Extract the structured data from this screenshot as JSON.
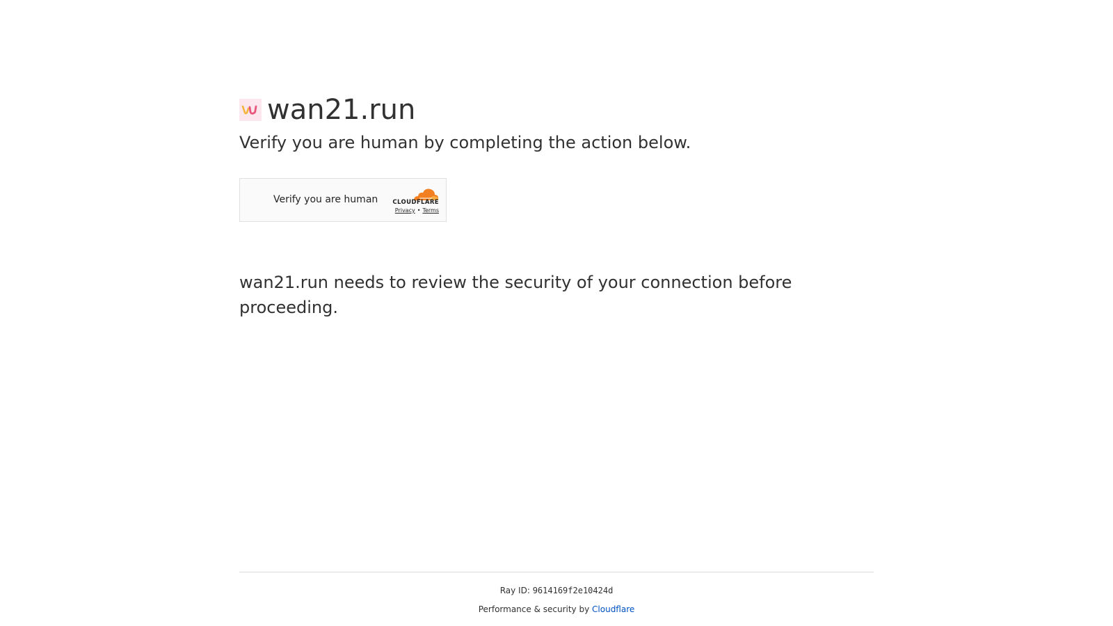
{
  "header": {
    "site_title": "wan21.run",
    "favicon_icon": "wan21-logo-icon"
  },
  "subtitle": "Verify you are human by completing the action below.",
  "widget": {
    "label": "Verify you are human",
    "brand": "CLOUDFLARE",
    "brand_icon": "cloudflare-cloud-icon",
    "privacy_link": "Privacy",
    "separator": "•",
    "terms_link": "Terms"
  },
  "review_message": "wan21.run needs to review the security of your connection before proceeding.",
  "footer": {
    "ray_label": "Ray ID:",
    "ray_id": "9614169f2e10424d",
    "perf_text": "Performance & security by",
    "cloudflare_link": "Cloudflare"
  },
  "colors": {
    "text": "#313131",
    "link": "#0051c3",
    "cloudflare_orange": "#f38020",
    "favicon_bg": "#fde7ef"
  }
}
